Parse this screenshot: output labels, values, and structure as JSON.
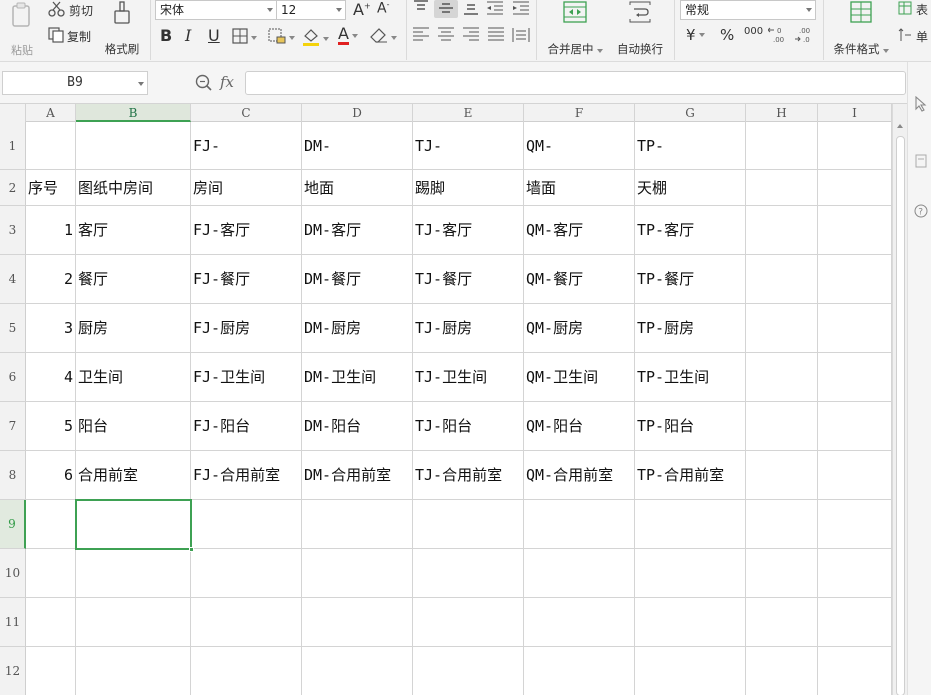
{
  "ribbon": {
    "paste_label": "粘贴",
    "cut_label": "剪切",
    "copy_label": "复制",
    "format_painter_label": "格式刷",
    "font_name": "宋体",
    "font_size": "12",
    "bold_label": "B",
    "italic_label": "I",
    "underline_label": "U",
    "font_color_label": "A",
    "merge_center_label": "合并居中",
    "wrap_text_label": "自动换行",
    "number_format": "常规",
    "currency_label": "¥",
    "percent_label": "%",
    "thousands_label": "000",
    "cond_format_label": "条件格式",
    "table_label": "表",
    "single_label": "单",
    "accent_color": "#3ea153"
  },
  "formula_bar": {
    "name_box": "B9",
    "fx_label": "fx",
    "formula_value": ""
  },
  "grid": {
    "columns": [
      "A",
      "B",
      "C",
      "D",
      "E",
      "F",
      "G",
      "H",
      "I"
    ],
    "active_column": "B",
    "rows": [
      {
        "num": "1",
        "cells": [
          "",
          "",
          "FJ-",
          "DM-",
          "TJ-",
          "QM-",
          "TP-",
          "",
          ""
        ]
      },
      {
        "num": "2",
        "cells": [
          "序号",
          "图纸中房间",
          "房间",
          "地面",
          "踢脚",
          "墙面",
          "天棚",
          "",
          ""
        ]
      },
      {
        "num": "3",
        "cells": [
          "1",
          "客厅",
          "FJ-客厅",
          "DM-客厅",
          "TJ-客厅",
          "QM-客厅",
          "TP-客厅",
          "",
          ""
        ]
      },
      {
        "num": "4",
        "cells": [
          "2",
          "餐厅",
          "FJ-餐厅",
          "DM-餐厅",
          "TJ-餐厅",
          "QM-餐厅",
          "TP-餐厅",
          "",
          ""
        ]
      },
      {
        "num": "5",
        "cells": [
          "3",
          "厨房",
          "FJ-厨房",
          "DM-厨房",
          "TJ-厨房",
          "QM-厨房",
          "TP-厨房",
          "",
          ""
        ]
      },
      {
        "num": "6",
        "cells": [
          "4",
          "卫生间",
          "FJ-卫生间",
          "DM-卫生间",
          "TJ-卫生间",
          "QM-卫生间",
          "TP-卫生间",
          "",
          ""
        ]
      },
      {
        "num": "7",
        "cells": [
          "5",
          "阳台",
          "FJ-阳台",
          "DM-阳台",
          "TJ-阳台",
          "QM-阳台",
          "TP-阳台",
          "",
          ""
        ]
      },
      {
        "num": "8",
        "cells": [
          "6",
          "合用前室",
          "FJ-合用前室",
          "DM-合用前室",
          "TJ-合用前室",
          "QM-合用前室",
          "TP-合用前室",
          "",
          ""
        ]
      },
      {
        "num": "9",
        "cells": [
          "",
          "",
          "",
          "",
          "",
          "",
          "",
          "",
          ""
        ]
      },
      {
        "num": "10",
        "cells": [
          "",
          "",
          "",
          "",
          "",
          "",
          "",
          "",
          ""
        ]
      },
      {
        "num": "11",
        "cells": [
          "",
          "",
          "",
          "",
          "",
          "",
          "",
          "",
          ""
        ]
      },
      {
        "num": "12",
        "cells": [
          "",
          "",
          "",
          "",
          "",
          "",
          "",
          "",
          ""
        ]
      }
    ],
    "selected_cell": "B9",
    "selected_row": "9"
  }
}
